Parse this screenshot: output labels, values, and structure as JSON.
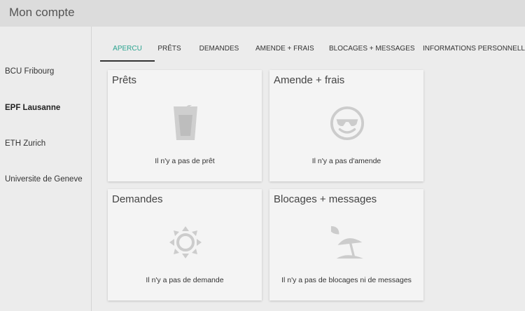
{
  "header": {
    "title": "Mon compte"
  },
  "sidebar": {
    "items": [
      {
        "label": "BCU Fribourg"
      },
      {
        "label": "EPF Lausanne"
      },
      {
        "label": "ETH Zurich"
      },
      {
        "label": "Universite de Geneve"
      }
    ],
    "active_index": 1
  },
  "tabs": [
    {
      "label": "APERCU"
    },
    {
      "label": "PRÊTS"
    },
    {
      "label": "DEMANDES"
    },
    {
      "label": "AMENDE + FRAIS"
    },
    {
      "label": "BLOCAGES + MESSAGES"
    },
    {
      "label": "INFORMATIONS PERSONNELLES"
    }
  ],
  "active_tab_index": 0,
  "cards": [
    {
      "title": "Prêts",
      "message": "Il n'y a pas de prêt",
      "icon": "glass-icon"
    },
    {
      "title": "Amende + frais",
      "message": "Il n'y a pas d'amende",
      "icon": "sunglasses-face-icon"
    },
    {
      "title": "Demandes",
      "message": "Il n'y a pas de demande",
      "icon": "sun-icon"
    },
    {
      "title": "Blocages + messages",
      "message": "Il n'y a pas de blocages ni de messages",
      "icon": "beach-umbrella-icon"
    }
  ],
  "colors": {
    "accent": "#2aa38f",
    "icon": "#cccccc",
    "card_bg": "#f4f4f4",
    "header_bg": "#dcdcdc"
  }
}
